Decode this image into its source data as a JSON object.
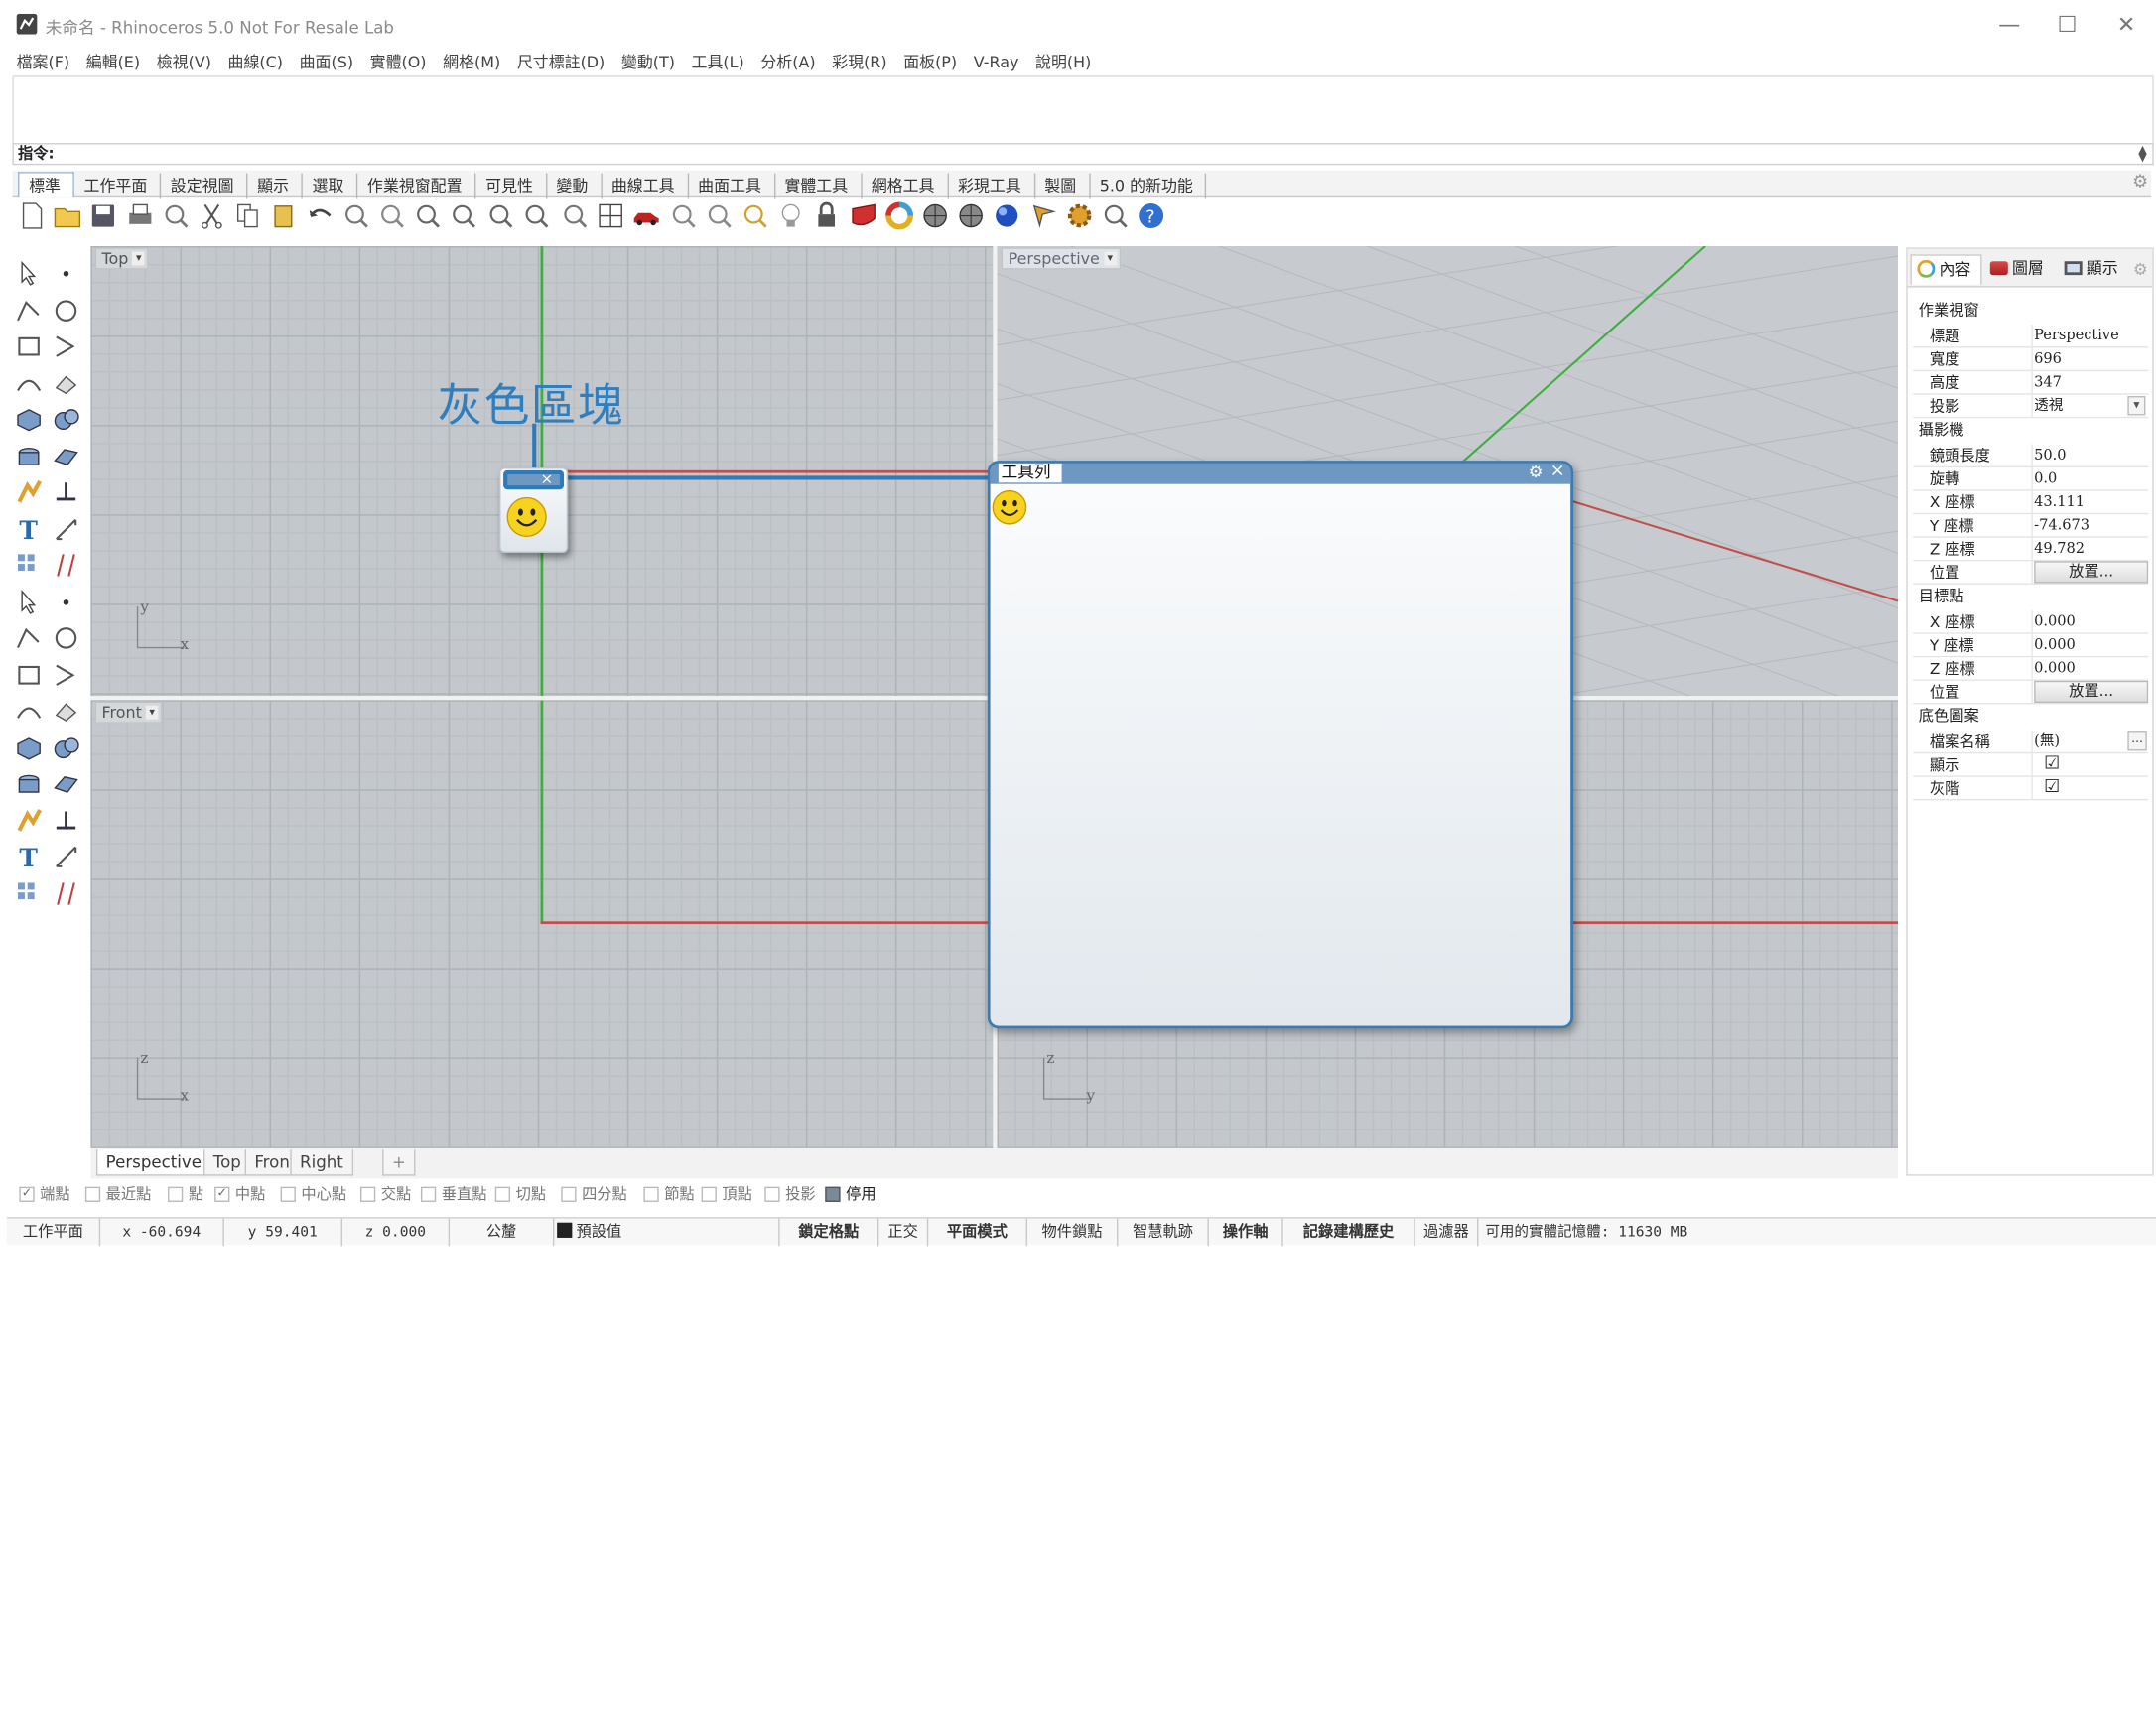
{
  "window": {
    "title": "未命名 - Rhinoceros 5.0 Not For Resale Lab",
    "minimize": "—",
    "maximize": "☐",
    "close": "✕"
  },
  "menu": [
    "檔案(F)",
    "編輯(E)",
    "檢視(V)",
    "曲線(C)",
    "曲面(S)",
    "實體(O)",
    "網格(M)",
    "尺寸標註(D)",
    "變動(T)",
    "工具(L)",
    "分析(A)",
    "彩現(R)",
    "面板(P)",
    "V-Ray",
    "說明(H)"
  ],
  "command": {
    "label": "指令:",
    "value": ""
  },
  "toolbar_tabs": [
    "標準",
    "工作平面",
    "設定視圖",
    "顯示",
    "選取",
    "作業視窗配置",
    "可見性",
    "變動",
    "曲線工具",
    "曲面工具",
    "實體工具",
    "網格工具",
    "彩現工具",
    "製圖",
    "5.0 的新功能"
  ],
  "toolbar_icons": [
    "new-file-icon",
    "open-folder-icon",
    "save-icon",
    "print-icon",
    "import-icon",
    "cut-icon",
    "copy-icon",
    "paste-icon",
    "undo-icon",
    "pan-hand-icon",
    "move-view-icon",
    "zoom-icon",
    "zoom-window-icon",
    "zoom-extents-icon",
    "zoom-selected-icon",
    "rotate-view-icon",
    "four-viewports-icon",
    "car-icon",
    "hide-icon",
    "show-icon",
    "select-points-icon",
    "light-bulb-icon",
    "lock-icon",
    "layer-icon",
    "color-wheel-icon",
    "render-sphere-icon",
    "shaded-sphere-icon",
    "render-icon",
    "pen-icon",
    "settings-gear-icon",
    "snap-icon",
    "help-icon"
  ],
  "left_tools": [
    "select-arrow-icon",
    "point-icon",
    "polyline-icon",
    "curve-points-icon",
    "circle-icon",
    "ellipse-icon",
    "arc-icon",
    "rectangle-icon",
    "circle-tangent-icon",
    "fillet-curve-icon",
    "surface-points-icon",
    "surface-icon",
    "box-icon",
    "sphere-icon",
    "extrude-icon",
    "loft-icon",
    "explode-icon",
    "split-icon",
    "trim-icon",
    "extend-icon",
    "boolean-icon",
    "group-icon",
    "fillet-icon",
    "chamfer-icon",
    "text-icon",
    "dimension-icon",
    "array-icon",
    "mirror-icon",
    "solid-tools-icon",
    "measure-icon",
    "grid-array-icon",
    "tools-icon",
    "analysis-icon",
    "check-icon",
    "mesh-icon",
    "paint-icon"
  ],
  "viewports": {
    "top": {
      "label": "Top",
      "axis_a": "y",
      "axis_b": "x"
    },
    "perspective": {
      "label": "Perspective"
    },
    "front": {
      "label": "Front",
      "axis_a": "z",
      "axis_b": "x"
    },
    "right": {
      "axis_a": "z",
      "axis_b": "y"
    }
  },
  "callout": {
    "text": "灰色區塊"
  },
  "floating_toolbar": {
    "title": "工具列",
    "gear": "⚙",
    "close": "×"
  },
  "small_block": {
    "close": "×"
  },
  "viewport_tabs": [
    "Perspective",
    "Top",
    "Front",
    "Right"
  ],
  "viewport_tab_add": "+",
  "osnaps": [
    {
      "label": "端點",
      "checked": true
    },
    {
      "label": "最近點",
      "checked": false
    },
    {
      "label": "點",
      "checked": false
    },
    {
      "label": "中點",
      "checked": true
    },
    {
      "label": "中心點",
      "checked": false
    },
    {
      "label": "交點",
      "checked": false
    },
    {
      "label": "垂直點",
      "checked": false
    },
    {
      "label": "切點",
      "checked": false
    },
    {
      "label": "四分點",
      "checked": false
    },
    {
      "label": "節點",
      "checked": false
    },
    {
      "label": "頂點",
      "checked": false
    },
    {
      "label": "投影",
      "checked": false
    },
    {
      "label": "停用",
      "checked": false
    }
  ],
  "status": {
    "cplane": "工作平面",
    "x": "x -60.694",
    "y": "y 59.401",
    "z": "z 0.000",
    "unit": "公釐",
    "layer": "預設值",
    "grid_snap": "鎖定格點",
    "ortho": "正交",
    "planar": "平面模式",
    "osnap": "物件鎖點",
    "smarttrack": "智慧軌跡",
    "gumball": "操作軸",
    "history": "記錄建構歷史",
    "filter": "過濾器",
    "memory": "可用的實體記憶體: 11630 MB"
  },
  "panel": {
    "tabs": [
      "內容",
      "圖層",
      "顯示"
    ],
    "section_viewport": "作業視窗",
    "rows_viewport": [
      {
        "k": "標題",
        "v": "Perspective"
      },
      {
        "k": "寬度",
        "v": "696"
      },
      {
        "k": "高度",
        "v": "347"
      },
      {
        "k": "投影",
        "v": "透視"
      }
    ],
    "section_camera": "攝影機",
    "rows_camera": [
      {
        "k": "鏡頭長度",
        "v": "50.0"
      },
      {
        "k": "旋轉",
        "v": "0.0"
      },
      {
        "k": "X 座標",
        "v": "43.111"
      },
      {
        "k": "Y 座標",
        "v": "-74.673"
      },
      {
        "k": "Z 座標",
        "v": "49.782"
      },
      {
        "k": "位置",
        "v": "放置..."
      }
    ],
    "section_target": "目標點",
    "rows_target": [
      {
        "k": "X 座標",
        "v": "0.000"
      },
      {
        "k": "Y 座標",
        "v": "0.000"
      },
      {
        "k": "Z 座標",
        "v": "0.000"
      },
      {
        "k": "位置",
        "v": "放置..."
      }
    ],
    "section_wallpaper": "底色圖案",
    "rows_wallpaper": [
      {
        "k": "檔案名稱",
        "v": "(無)"
      },
      {
        "k": "顯示",
        "v": "☑"
      },
      {
        "k": "灰階",
        "v": "☑"
      }
    ],
    "browse": "..."
  },
  "colors": {
    "accent": "#2f7ebd",
    "x_axis": "#c0504d",
    "y_axis": "#3fae3f",
    "viewport_bg": "#c4c8cc"
  }
}
